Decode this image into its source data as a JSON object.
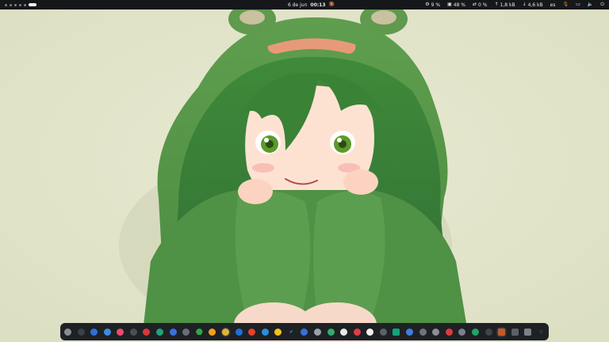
{
  "topbar": {
    "date": "6 de jun",
    "time": "00:13",
    "cpu": "9 %",
    "memory": "48 %",
    "swap": "0 %",
    "net_up": "1,8 kB",
    "net_down": "4,6 kB",
    "keyboard_layout": "es",
    "icons": {
      "bell_off": "🔕",
      "cpu": "⚙",
      "memory": "▣",
      "swap": "⇄",
      "up": "↑",
      "down": "↓",
      "mic": "🎙",
      "display": "▭",
      "volume": "🔈",
      "power": "⏻"
    }
  },
  "dock": {
    "apps": [
      {
        "name": "dock-app-1",
        "color": "#8a8d92",
        "shape": "circle"
      },
      {
        "name": "dock-app-2",
        "color": "#3a4048",
        "shape": "circle"
      },
      {
        "name": "dock-app-3",
        "color": "#2f6fd6",
        "shape": "circle"
      },
      {
        "name": "dock-app-4",
        "color": "#3d8be0",
        "shape": "circle"
      },
      {
        "name": "dock-app-5",
        "color": "#e94d6b",
        "shape": "circle"
      },
      {
        "name": "dock-app-6",
        "color": "#4a4f55",
        "shape": "circle"
      },
      {
        "name": "dock-app-7",
        "color": "#d8383a",
        "shape": "circle"
      },
      {
        "name": "dock-app-8",
        "color": "#1fa37a",
        "shape": "circle"
      },
      {
        "name": "dock-app-9",
        "color": "#3b6fe0",
        "shape": "circle"
      },
      {
        "name": "dock-app-10",
        "color": "#6a6e74",
        "shape": "circle"
      },
      {
        "name": "dock-app-11",
        "color": "#2ea84a",
        "shape": "hex"
      },
      {
        "name": "dock-app-12",
        "color": "#f2a019",
        "shape": "circle"
      },
      {
        "name": "dock-app-13",
        "color": "#e0b43a",
        "shape": "circle",
        "running": true
      },
      {
        "name": "dock-app-14",
        "color": "#1f6fd6",
        "shape": "circle"
      },
      {
        "name": "dock-app-15",
        "color": "#e2412f",
        "shape": "circle"
      },
      {
        "name": "dock-app-16",
        "color": "#2a8de0",
        "shape": "circle"
      },
      {
        "name": "dock-app-17",
        "color": "#f3c21a",
        "shape": "circle"
      },
      {
        "name": "dock-app-18",
        "color": "#4c8ee8",
        "shape": "check"
      },
      {
        "name": "dock-app-19",
        "color": "#3a6fd8",
        "shape": "circle"
      },
      {
        "name": "dock-app-20",
        "color": "#9aa0a6",
        "shape": "circle"
      },
      {
        "name": "dock-app-21",
        "color": "#2fae6b",
        "shape": "circle"
      },
      {
        "name": "dock-app-22",
        "color": "#e8e8e8",
        "shape": "circle"
      },
      {
        "name": "dock-app-23",
        "color": "#e23b4a",
        "shape": "circle"
      },
      {
        "name": "dock-app-24",
        "color": "#f2f2f2",
        "shape": "circle"
      },
      {
        "name": "dock-app-25",
        "color": "#5a6068",
        "shape": "circle"
      },
      {
        "name": "dock-app-26",
        "color": "#12a37a",
        "shape": "sq"
      },
      {
        "name": "dock-app-27",
        "color": "#3e7fe0",
        "shape": "circle"
      },
      {
        "name": "dock-app-28",
        "color": "#6f757c",
        "shape": "circle"
      },
      {
        "name": "dock-app-29",
        "color": "#8a8f96",
        "shape": "circle"
      },
      {
        "name": "dock-app-30",
        "color": "#dd3b3b",
        "shape": "circle"
      },
      {
        "name": "dock-app-31",
        "color": "#7a8088",
        "shape": "circle"
      },
      {
        "name": "dock-app-32",
        "color": "#21a36a",
        "shape": "circle"
      },
      {
        "name": "dock-app-33",
        "color": "#3f4449",
        "shape": "circle"
      },
      {
        "name": "dock-app-34",
        "color": "#c05a2a",
        "shape": "sq",
        "running": true
      },
      {
        "name": "dock-app-35",
        "color": "#5b6168",
        "shape": "sq"
      },
      {
        "name": "dock-app-36",
        "color": "#7c8188",
        "shape": "sq"
      },
      {
        "name": "dock-app-37",
        "color": "#b8bcc2",
        "shape": "grid"
      }
    ]
  }
}
